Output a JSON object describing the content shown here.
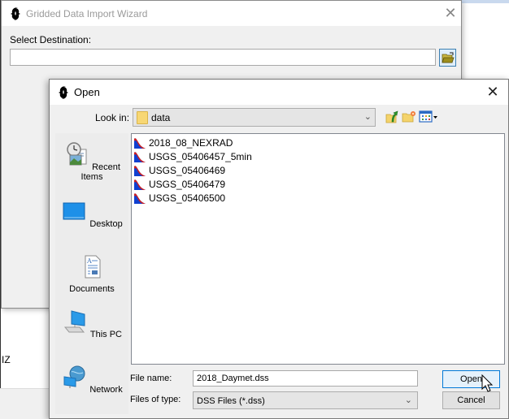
{
  "background": {
    "text_fragment": "IZ"
  },
  "wizard": {
    "title": "Gridded Data Import Wizard",
    "close_icon": "close-icon",
    "select_destination_label": "Select Destination:",
    "destination_value": "",
    "browse_icon": "open-folder-icon"
  },
  "open_dialog": {
    "title": "Open",
    "look_in_label": "Look in:",
    "look_in_value": "data",
    "toolbar": {
      "up_icon": "up-one-level-icon",
      "new_folder_icon": "new-folder-icon",
      "view_menu_icon": "view-menu-icon"
    },
    "places": [
      {
        "label": "Recent Items",
        "icon": "recent-items-icon"
      },
      {
        "label": "Desktop",
        "icon": "desktop-icon"
      },
      {
        "label": "Documents",
        "icon": "documents-icon"
      },
      {
        "label": "This PC",
        "icon": "this-pc-icon"
      },
      {
        "label": "Network",
        "icon": "network-icon"
      }
    ],
    "files": [
      {
        "name": "2018_08_NEXRAD"
      },
      {
        "name": "USGS_05406457_5min"
      },
      {
        "name": "USGS_05406469"
      },
      {
        "name": "USGS_05406479"
      },
      {
        "name": "USGS_05406500"
      }
    ],
    "file_name_label": "File name:",
    "file_name_value": "2018_Daymet.dss",
    "files_of_type_label": "Files of type:",
    "files_of_type_value": "DSS Files (*.dss)",
    "open_button": "Open",
    "cancel_button": "Cancel"
  }
}
